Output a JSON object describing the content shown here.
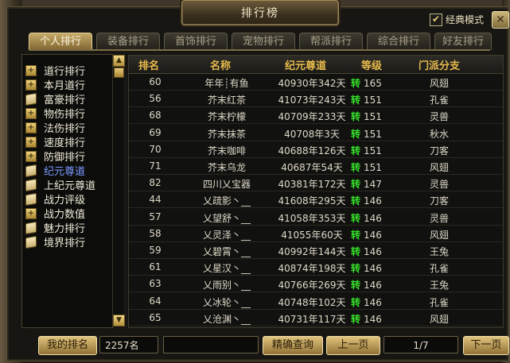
{
  "window": {
    "title": "排行榜",
    "classic_mode_label": "经典模式",
    "classic_checked": true,
    "close_icon": "close-icon"
  },
  "tabs": [
    {
      "label": "个人排行",
      "active": true
    },
    {
      "label": "装备排行",
      "active": false
    },
    {
      "label": "首饰排行",
      "active": false
    },
    {
      "label": "宠物排行",
      "active": false
    },
    {
      "label": "帮派排行",
      "active": false
    },
    {
      "label": "综合排行",
      "active": false
    },
    {
      "label": "好友排行",
      "active": false
    }
  ],
  "sidebar": {
    "items": [
      {
        "label": "道行排行",
        "icon": "plus-icon",
        "active": false
      },
      {
        "label": "本月道行",
        "icon": "plus-icon",
        "active": false
      },
      {
        "label": "富豪排行",
        "icon": "book-icon",
        "active": false
      },
      {
        "label": "物伤排行",
        "icon": "plus-icon",
        "active": false
      },
      {
        "label": "法伤排行",
        "icon": "plus-icon",
        "active": false
      },
      {
        "label": "速度排行",
        "icon": "plus-icon",
        "active": false
      },
      {
        "label": "防御排行",
        "icon": "plus-icon",
        "active": false
      },
      {
        "label": "纪元尊道",
        "icon": "book-icon",
        "active": true
      },
      {
        "label": "上纪元尊道",
        "icon": "book-icon",
        "active": false
      },
      {
        "label": "战力评级",
        "icon": "book-icon",
        "active": false
      },
      {
        "label": "战力数值",
        "icon": "plus-icon",
        "active": false
      },
      {
        "label": "魅力排行",
        "icon": "book-icon",
        "active": false
      },
      {
        "label": "境界排行",
        "icon": "book-icon",
        "active": false
      }
    ]
  },
  "table": {
    "headers": [
      "排名",
      "名称",
      "纪元尊道",
      "等级",
      "门派分支"
    ],
    "level_prefix": "转",
    "rows": [
      {
        "rank": "60",
        "name": "年年┊有鱼",
        "value": "40930年342天",
        "level": "165",
        "branch": "风翅"
      },
      {
        "rank": "56",
        "name": "芥末红茶",
        "value": "41073年243天",
        "level": "151",
        "branch": "孔雀"
      },
      {
        "rank": "68",
        "name": "芥末柠檬",
        "value": "40709年233天",
        "level": "151",
        "branch": "灵兽"
      },
      {
        "rank": "69",
        "name": "芥末抹茶",
        "value": "40708年3天",
        "level": "151",
        "branch": "秋水"
      },
      {
        "rank": "70",
        "name": "芥末咖啡",
        "value": "40688年126天",
        "level": "151",
        "branch": "刀客"
      },
      {
        "rank": "71",
        "name": "芥末乌龙",
        "value": "40687年54天",
        "level": "151",
        "branch": "风翅"
      },
      {
        "rank": "82",
        "name": "四川乂宝器",
        "value": "40381年172天",
        "level": "147",
        "branch": "灵兽"
      },
      {
        "rank": "44",
        "name": "乂疏影丶__",
        "value": "41608年295天",
        "level": "146",
        "branch": "刀客"
      },
      {
        "rank": "57",
        "name": "乂望舒丶__",
        "value": "41058年353天",
        "level": "146",
        "branch": "灵兽"
      },
      {
        "rank": "58",
        "name": "乂灵泽丶__",
        "value": "41055年60天",
        "level": "146",
        "branch": "风翅"
      },
      {
        "rank": "59",
        "name": "乂碧霄丶__",
        "value": "40992年144天",
        "level": "146",
        "branch": "王兔"
      },
      {
        "rank": "61",
        "name": "乂星汉丶__",
        "value": "40874年198天",
        "level": "146",
        "branch": "孔雀"
      },
      {
        "rank": "63",
        "name": "乂雨别丶__",
        "value": "40766年269天",
        "level": "146",
        "branch": "王兔"
      },
      {
        "rank": "64",
        "name": "乂冰轮丶__",
        "value": "40748年102天",
        "level": "146",
        "branch": "孔雀"
      },
      {
        "rank": "65",
        "name": "乂沧渊丶__",
        "value": "40731年117天",
        "level": "146",
        "branch": "风翅"
      }
    ]
  },
  "footer": {
    "my_rank_label": "我的排名",
    "my_rank_value": "2257名",
    "search_value": "",
    "search_button": "精确查询",
    "prev_button": "上一页",
    "page_indicator": "1/7",
    "next_button": "下一页"
  }
}
